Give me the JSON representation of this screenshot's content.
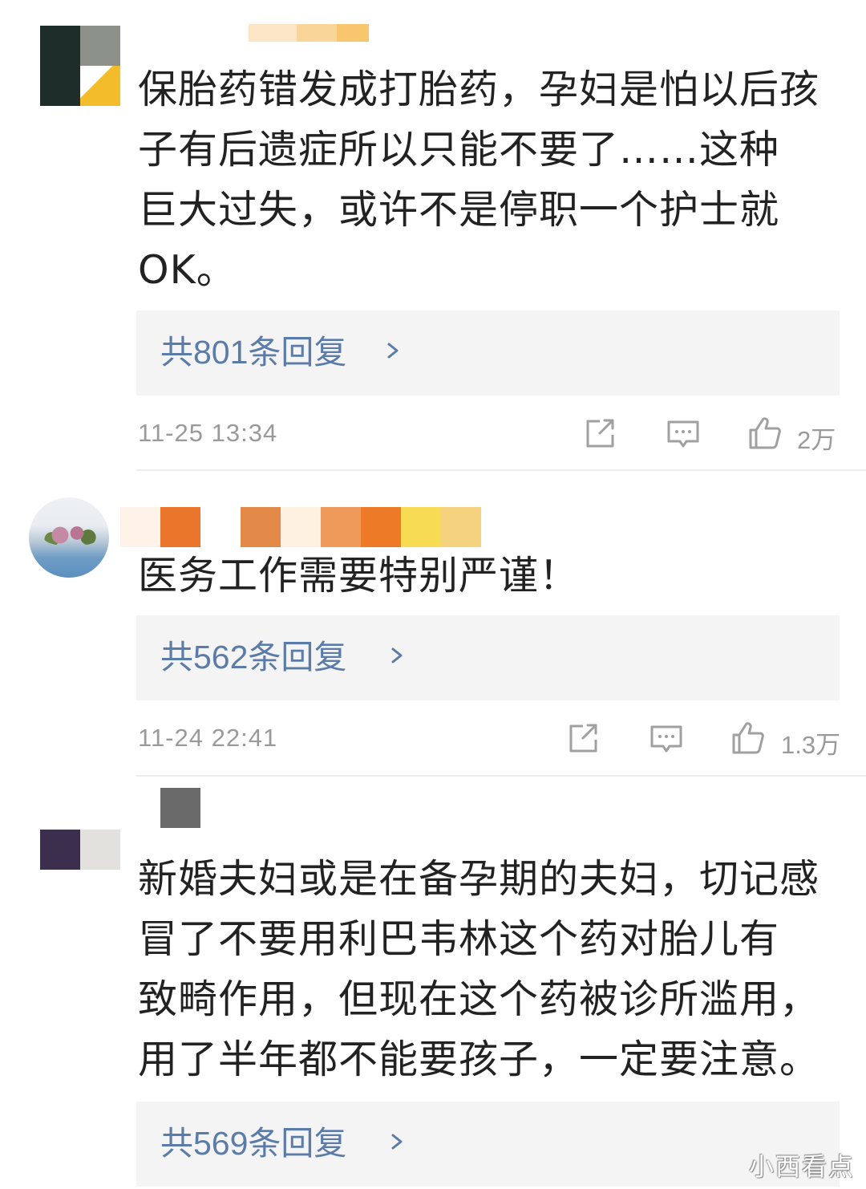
{
  "comments": [
    {
      "text": "保胎药错发成打胎药，孕妇是怕以后孩\n子有后遗症所以只能不要了……这种\n巨大过失，或许不是停职一个护士就\nOK。",
      "reply_label": "共801条回复",
      "timestamp": "11-25 13:34",
      "like_count": "2万",
      "colors": {
        "avatar": [
          "#1f2d2a",
          "#8c9289",
          "#ffffff",
          "#f3bc2a"
        ],
        "name": [
          "#fde6c8",
          "#fad59a",
          "#f7c66d"
        ]
      }
    },
    {
      "text": "医务工作需要特别严谨！",
      "reply_label": "共562条回复",
      "timestamp": "11-24 22:41",
      "like_count": "1.3万",
      "colors": {
        "name": [
          "#fff2e8",
          "#e9762b",
          "#ffffff",
          "#e48a48",
          "#fff1e2",
          "#ee9a5a",
          "#ec7a26",
          "#f7dc53",
          "#f4d27e"
        ]
      }
    },
    {
      "text": "新婚夫妇或是在备孕期的夫妇，切记感\n冒了不要用利巴韦林这个药对胎儿有\n致畸作用，但现在这个药被诊所滥用，\n用了半年都不能要孩子，一定要注意。",
      "reply_label": "共569条回复",
      "colors": {
        "avatar": [
          "#ffffff",
          "#ffffff",
          "#3c2f4d",
          "#e3e1de"
        ],
        "name": [
          "#6a6a6a"
        ]
      }
    }
  ],
  "icons": {
    "share": "share-icon",
    "comment": "comment-icon",
    "like": "thumbs-up-icon",
    "chevron": "chevron-right-icon"
  },
  "theme": {
    "link_color": "#5b7ba8",
    "meta_color": "#9a9a9a",
    "text_color": "#222222",
    "reply_bg": "#f4f4f4"
  },
  "watermark": "小西看点"
}
